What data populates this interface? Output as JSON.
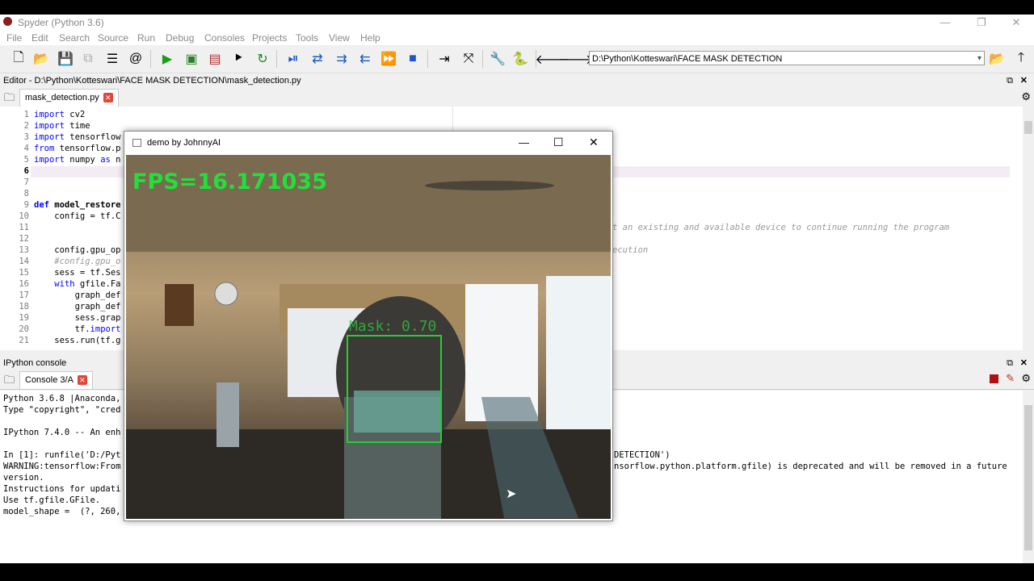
{
  "app": {
    "title": "Spyder (Python 3.6)",
    "window_controls": [
      "—",
      "❐",
      "✕"
    ]
  },
  "menu": [
    "File",
    "Edit",
    "Search",
    "Source",
    "Run",
    "Debug",
    "Consoles",
    "Projects",
    "Tools",
    "View",
    "Help"
  ],
  "toolbar": {
    "working_dir": "D:\\Python\\Kotteswari\\FACE MASK DETECTION"
  },
  "editor": {
    "pane_title": "Editor - D:\\Python\\Kotteswari\\FACE MASK DETECTION\\mask_detection.py",
    "tab_label": "mask_detection.py",
    "line_numbers": [
      "1",
      "2",
      "3",
      "4",
      "5",
      "6",
      "7",
      "8",
      "9",
      "10",
      "11",
      "12",
      "13",
      "14",
      "15",
      "16",
      "17",
      "18",
      "19",
      "20",
      "21"
    ],
    "lines": [
      "import cv2",
      "import time",
      "import tensorflow",
      "from tensorflow.p",
      "import numpy as n",
      "",
      "",
      "",
      "def model_restore",
      "    config = tf.C",
      "",
      "",
      "    config.gpu_op",
      "    #config.gpu_o",
      "    sess = tf.Ses",
      "    with gfile.Fa",
      "        graph_def",
      "        graph_def",
      "        sess.grap",
      "        tf.import",
      "    sess.run(tf.g"
    ],
    "right_text_1": "t an existing and available device to continue running the program",
    "right_text_2": "ecution"
  },
  "console": {
    "pane_title": "IPython console",
    "tab_label": "Console 3/A",
    "lines": [
      "Python 3.6.8 |Anaconda,",
      "Type \"copyright\", \"cred",
      "",
      "IPython 7.4.0 -- An enh",
      "",
      "In [1]: runfile('D:/Pyt",
      "WARNING:tensorflow:From",
      "version.",
      "Instructions for updati",
      "Use tf.gfile.GFile.",
      "model_shape =  (?, 260,"
    ],
    "right_line_1": "DETECTION')",
    "right_line_2": "nsorflow.python.platform.gfile) is deprecated and will be removed in a future"
  },
  "cv_window": {
    "title": "demo by JohnnyAI",
    "fps_text": "FPS=16.171035",
    "mask_label": "Mask: 0.70",
    "controls": [
      "—",
      "☐",
      "✕"
    ]
  },
  "colors": {
    "detection_green": "#22e03a",
    "keyword_blue": "#0000ff",
    "error_red": "#e0483a"
  }
}
